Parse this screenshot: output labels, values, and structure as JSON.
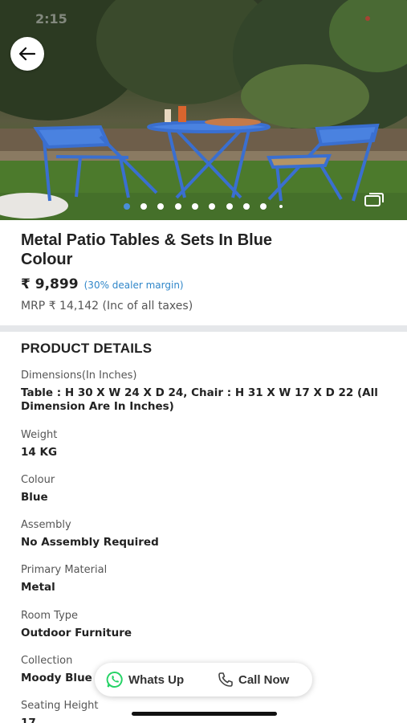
{
  "status_bar": {
    "time": "2:15"
  },
  "hero": {
    "back_icon": "arrow-left-icon",
    "gallery_icon": "gallery-stack-icon",
    "image_count": 10,
    "active_image": 1
  },
  "product": {
    "title": "Metal Patio Tables & Sets In Blue Colour",
    "price": "₹ 9,899",
    "dealer_margin": "(30% dealer margin)",
    "mrp": "MRP ₹ 14,142 (Inc of all taxes)"
  },
  "details": {
    "heading": "PRODUCT DETAILS",
    "specs": [
      {
        "label": "Dimensions(In Inches)",
        "value": "Table : H 30 X W 24 X D 24, Chair : H 31 X W 17 X D 22 (All Dimension Are In Inches)"
      },
      {
        "label": "Weight",
        "value": "14 KG"
      },
      {
        "label": "Colour",
        "value": "Blue"
      },
      {
        "label": "Assembly",
        "value": "No Assembly Required"
      },
      {
        "label": "Primary Material",
        "value": "Metal"
      },
      {
        "label": "Room Type",
        "value": "Outdoor Furniture"
      },
      {
        "label": "Collection",
        "value": "Moody Blue"
      },
      {
        "label": "Seating Height",
        "value": "17"
      }
    ]
  },
  "actions": {
    "whatsapp_label": "Whats Up",
    "call_label": "Call Now"
  },
  "colors": {
    "accent": "#2f86c9",
    "whatsapp": "#25d366",
    "text": "#222222",
    "divider": "#e5e7ea"
  }
}
